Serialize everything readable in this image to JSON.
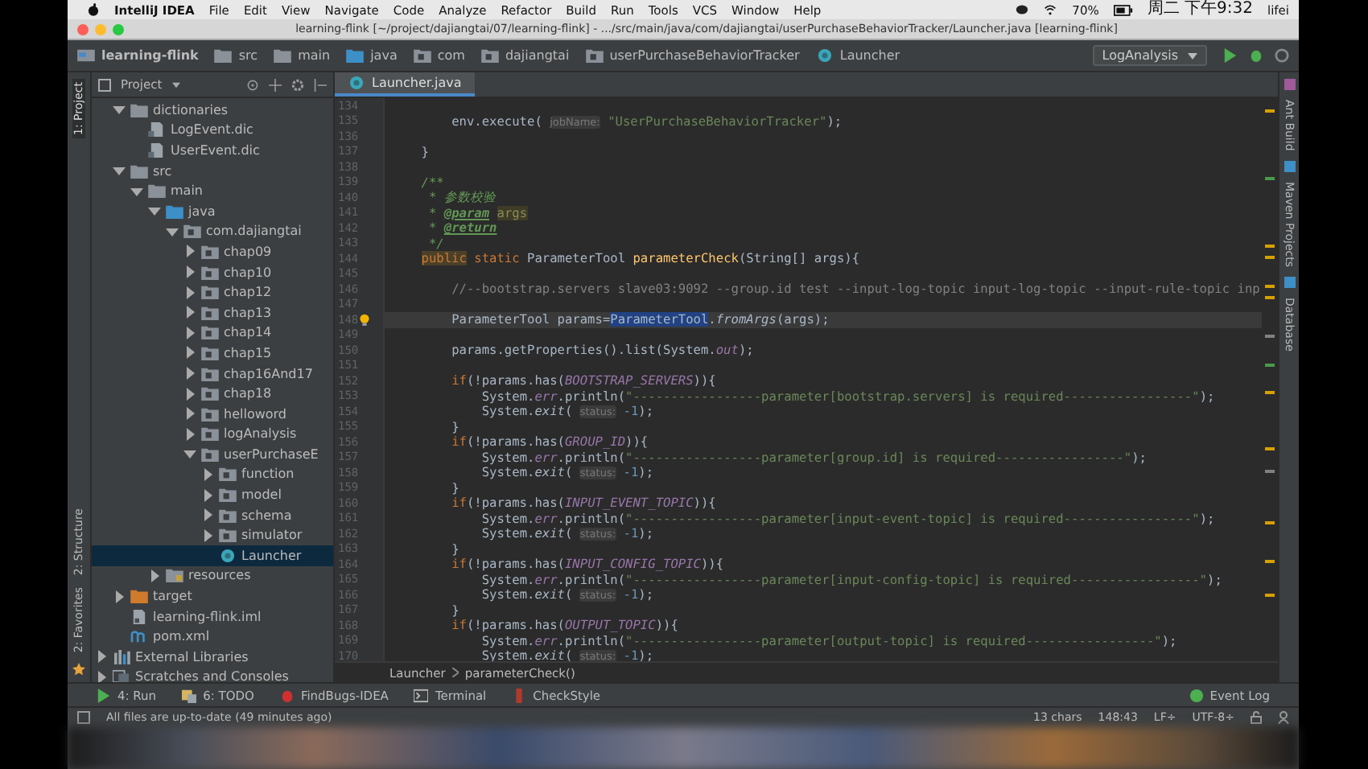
{
  "menu_bar": {
    "app": "IntelliJ IDEA",
    "items": [
      "File",
      "Edit",
      "View",
      "Navigate",
      "Code",
      "Analyze",
      "Refactor",
      "Build",
      "Run",
      "Tools",
      "VCS",
      "Window",
      "Help"
    ],
    "battery": "70%",
    "clock": "周二 下午9:32",
    "user": "lifei"
  },
  "window": {
    "title": "learning-flink [~/project/dajiangtai/07/learning-flink] - .../src/main/java/com/dajiangtai/userPurchaseBehaviorTracker/Launcher.java [learning-flink]"
  },
  "nav_bar": {
    "crumbs": [
      {
        "label": "learning-flink",
        "kind": "module"
      },
      {
        "label": "src",
        "kind": "folder"
      },
      {
        "label": "main",
        "kind": "folder"
      },
      {
        "label": "java",
        "kind": "source-folder"
      },
      {
        "label": "com",
        "kind": "package"
      },
      {
        "label": "dajiangtai",
        "kind": "package"
      },
      {
        "label": "userPurchaseBehaviorTracker",
        "kind": "package"
      },
      {
        "label": "Launcher",
        "kind": "class"
      }
    ],
    "run_config": "LogAnalysis"
  },
  "left_stripe": [
    {
      "label": "1: Project",
      "selected": true
    },
    {
      "label": "2: Structure",
      "selected": false
    },
    {
      "label": "2: Favorites",
      "selected": false
    }
  ],
  "right_stripe": [
    "Ant Build",
    "Maven Projects",
    "Database"
  ],
  "project_panel": {
    "title": "Project",
    "tree": [
      {
        "label": "dictionaries",
        "kind": "folder",
        "expanded": true,
        "selected": false,
        "children": [
          {
            "label": "LogEvent.dic",
            "kind": "dic",
            "selected": false
          },
          {
            "label": "UserEvent.dic",
            "kind": "dic",
            "selected": false
          }
        ]
      },
      {
        "label": "src",
        "kind": "folder",
        "expanded": true,
        "selected": false,
        "children": [
          {
            "label": "main",
            "kind": "folder",
            "expanded": true,
            "selected": false,
            "children": [
              {
                "label": "java",
                "kind": "source-folder",
                "expanded": true,
                "selected": false,
                "children": [
                  {
                    "label": "com.dajiangtai",
                    "kind": "package",
                    "expanded": true,
                    "selected": false,
                    "children": [
                      {
                        "label": "chap09",
                        "kind": "package",
                        "expanded": false,
                        "selected": false
                      },
                      {
                        "label": "chap10",
                        "kind": "package",
                        "expanded": false,
                        "selected": false
                      },
                      {
                        "label": "chap12",
                        "kind": "package",
                        "expanded": false,
                        "selected": false
                      },
                      {
                        "label": "chap13",
                        "kind": "package",
                        "expanded": false,
                        "selected": false
                      },
                      {
                        "label": "chap14",
                        "kind": "package",
                        "expanded": false,
                        "selected": false
                      },
                      {
                        "label": "chap15",
                        "kind": "package",
                        "expanded": false,
                        "selected": false
                      },
                      {
                        "label": "chap16And17",
                        "kind": "package",
                        "expanded": false,
                        "selected": false
                      },
                      {
                        "label": "chap18",
                        "kind": "package",
                        "expanded": false,
                        "selected": false
                      },
                      {
                        "label": "helloword",
                        "kind": "package",
                        "expanded": false,
                        "selected": false
                      },
                      {
                        "label": "logAnalysis",
                        "kind": "package",
                        "expanded": false,
                        "selected": false
                      },
                      {
                        "label": "userPurchaseE",
                        "kind": "package",
                        "expanded": true,
                        "selected": false,
                        "children": [
                          {
                            "label": "function",
                            "kind": "package",
                            "expanded": false,
                            "selected": false
                          },
                          {
                            "label": "model",
                            "kind": "package",
                            "expanded": false,
                            "selected": false
                          },
                          {
                            "label": "schema",
                            "kind": "package",
                            "expanded": false,
                            "selected": false
                          },
                          {
                            "label": "simulator",
                            "kind": "package",
                            "expanded": false,
                            "selected": false
                          },
                          {
                            "label": "Launcher",
                            "kind": "class",
                            "selected": true
                          }
                        ]
                      }
                    ]
                  }
                ]
              },
              {
                "label": "resources",
                "kind": "resources",
                "expanded": false,
                "selected": false
              }
            ]
          }
        ]
      },
      {
        "label": "target",
        "kind": "excluded-folder",
        "expanded": false,
        "selected": false
      },
      {
        "label": "learning-flink.iml",
        "kind": "iml",
        "selected": false
      },
      {
        "label": "pom.xml",
        "kind": "maven",
        "selected": false
      }
    ],
    "roots": [
      {
        "label": "External Libraries",
        "kind": "libraries",
        "expanded": false,
        "selected": false
      },
      {
        "label": "Scratches and Consoles",
        "kind": "scratches",
        "expanded": false,
        "selected": false
      }
    ]
  },
  "editor": {
    "tabs": [
      {
        "label": "Launcher.java",
        "selected": true
      }
    ],
    "lines": [
      {
        "n": "134"
      },
      {
        "n": "135",
        "tokens": [
          {
            "text": "        env.execute( ",
            "kind": "plain"
          },
          {
            "text": "jobName:",
            "kind": "hint"
          },
          {
            "text": " \"UserPurchaseBehaviorTracker\"",
            "kind": "str"
          },
          {
            "text": ");",
            "kind": "plain"
          }
        ]
      },
      {
        "n": "136"
      },
      {
        "n": "137",
        "tokens": [
          {
            "text": "    }",
            "kind": "plain"
          }
        ]
      },
      {
        "n": "138"
      },
      {
        "n": "139",
        "tokens": [
          {
            "text": "    /**",
            "kind": "doc"
          }
        ]
      },
      {
        "n": "140",
        "tokens": [
          {
            "text": "     * 参数校验",
            "kind": "doc"
          }
        ]
      },
      {
        "n": "141",
        "tokens": [
          {
            "text": "     * ",
            "kind": "doc"
          },
          {
            "text": "@param",
            "kind": "doctag"
          },
          {
            "text": " args",
            "kind": "docparam"
          }
        ]
      },
      {
        "n": "142",
        "tokens": [
          {
            "text": "     * ",
            "kind": "doc"
          },
          {
            "text": "@return",
            "kind": "doctag"
          }
        ]
      },
      {
        "n": "143",
        "tokens": [
          {
            "text": "     */",
            "kind": "doc"
          }
        ]
      },
      {
        "n": "144",
        "tokens": [
          {
            "text": "    public",
            "kind": "kwhl"
          },
          {
            "text": " static ",
            "kind": "kw"
          },
          {
            "text": "ParameterTool ",
            "kind": "plain"
          },
          {
            "text": "parameterCheck",
            "kind": "fn"
          },
          {
            "text": "(String[] args){",
            "kind": "plain"
          }
        ]
      },
      {
        "n": "145"
      },
      {
        "n": "146",
        "tokens": [
          {
            "text": "        //--bootstrap.servers slave03:9092 --group.id test --input-log-topic input-log-topic --input-rule-topic inp",
            "kind": "comment"
          }
        ]
      },
      {
        "n": "147"
      },
      {
        "n": "148",
        "current": true,
        "bulb": true,
        "tokens": [
          {
            "text": "        ParameterTool params=",
            "kind": "plain"
          },
          {
            "text": "ParameterTool",
            "kind": "sel"
          },
          {
            "text": ".",
            "kind": "plain"
          },
          {
            "text": "fromArgs",
            "kind": "static"
          },
          {
            "text": "(args);",
            "kind": "plain"
          }
        ]
      },
      {
        "n": "149"
      },
      {
        "n": "150",
        "tokens": [
          {
            "text": "        params.getProperties().list(System.",
            "kind": "plain"
          },
          {
            "text": "out",
            "kind": "field"
          },
          {
            "text": ");",
            "kind": "plain"
          }
        ]
      },
      {
        "n": "151"
      },
      {
        "n": "152",
        "tokens": [
          {
            "text": "        if",
            "kind": "kw"
          },
          {
            "text": "(!params.has(",
            "kind": "plain"
          },
          {
            "text": "BOOTSTRAP_SERVERS",
            "kind": "field"
          },
          {
            "text": ")){",
            "kind": "plain"
          }
        ]
      },
      {
        "n": "153",
        "tokens": [
          {
            "text": "            System.",
            "kind": "plain"
          },
          {
            "text": "err",
            "kind": "field"
          },
          {
            "text": ".println(",
            "kind": "plain"
          },
          {
            "text": "\"-----------------parameter[bootstrap.servers] is required-----------------\"",
            "kind": "str"
          },
          {
            "text": ");",
            "kind": "plain"
          }
        ]
      },
      {
        "n": "154",
        "tokens": [
          {
            "text": "            System.",
            "kind": "plain"
          },
          {
            "text": "exit",
            "kind": "static"
          },
          {
            "text": "( ",
            "kind": "plain"
          },
          {
            "text": "status:",
            "kind": "hint"
          },
          {
            "text": " -1",
            "kind": "num"
          },
          {
            "text": ");",
            "kind": "plain"
          }
        ]
      },
      {
        "n": "155",
        "tokens": [
          {
            "text": "        }",
            "kind": "plain"
          }
        ]
      },
      {
        "n": "156",
        "tokens": [
          {
            "text": "        if",
            "kind": "kw"
          },
          {
            "text": "(!params.has(",
            "kind": "plain"
          },
          {
            "text": "GROUP_ID",
            "kind": "field"
          },
          {
            "text": ")){",
            "kind": "plain"
          }
        ]
      },
      {
        "n": "157",
        "tokens": [
          {
            "text": "            System.",
            "kind": "plain"
          },
          {
            "text": "err",
            "kind": "field"
          },
          {
            "text": ".println(",
            "kind": "plain"
          },
          {
            "text": "\"-----------------parameter[group.id] is required-----------------\"",
            "kind": "str"
          },
          {
            "text": ");",
            "kind": "plain"
          }
        ]
      },
      {
        "n": "158",
        "tokens": [
          {
            "text": "            System.",
            "kind": "plain"
          },
          {
            "text": "exit",
            "kind": "static"
          },
          {
            "text": "( ",
            "kind": "plain"
          },
          {
            "text": "status:",
            "kind": "hint"
          },
          {
            "text": " -1",
            "kind": "num"
          },
          {
            "text": ");",
            "kind": "plain"
          }
        ]
      },
      {
        "n": "159",
        "tokens": [
          {
            "text": "        }",
            "kind": "plain"
          }
        ]
      },
      {
        "n": "160",
        "tokens": [
          {
            "text": "        if",
            "kind": "kw"
          },
          {
            "text": "(!params.has(",
            "kind": "plain"
          },
          {
            "text": "INPUT_EVENT_TOPIC",
            "kind": "field"
          },
          {
            "text": ")){",
            "kind": "plain"
          }
        ]
      },
      {
        "n": "161",
        "tokens": [
          {
            "text": "            System.",
            "kind": "plain"
          },
          {
            "text": "err",
            "kind": "field"
          },
          {
            "text": ".println(",
            "kind": "plain"
          },
          {
            "text": "\"-----------------parameter[input-event-topic] is required-----------------\"",
            "kind": "str"
          },
          {
            "text": ");",
            "kind": "plain"
          }
        ]
      },
      {
        "n": "162",
        "tokens": [
          {
            "text": "            System.",
            "kind": "plain"
          },
          {
            "text": "exit",
            "kind": "static"
          },
          {
            "text": "( ",
            "kind": "plain"
          },
          {
            "text": "status:",
            "kind": "hint"
          },
          {
            "text": " -1",
            "kind": "num"
          },
          {
            "text": ");",
            "kind": "plain"
          }
        ]
      },
      {
        "n": "163",
        "tokens": [
          {
            "text": "        }",
            "kind": "plain"
          }
        ]
      },
      {
        "n": "164",
        "tokens": [
          {
            "text": "        if",
            "kind": "kw"
          },
          {
            "text": "(!params.has(",
            "kind": "plain"
          },
          {
            "text": "INPUT_CONFIG_TOPIC",
            "kind": "field"
          },
          {
            "text": ")){",
            "kind": "plain"
          }
        ]
      },
      {
        "n": "165",
        "tokens": [
          {
            "text": "            System.",
            "kind": "plain"
          },
          {
            "text": "err",
            "kind": "field"
          },
          {
            "text": ".println(",
            "kind": "plain"
          },
          {
            "text": "\"-----------------parameter[input-config-topic] is required-----------------\"",
            "kind": "str"
          },
          {
            "text": ");",
            "kind": "plain"
          }
        ]
      },
      {
        "n": "166",
        "tokens": [
          {
            "text": "            System.",
            "kind": "plain"
          },
          {
            "text": "exit",
            "kind": "static"
          },
          {
            "text": "( ",
            "kind": "plain"
          },
          {
            "text": "status:",
            "kind": "hint"
          },
          {
            "text": " -1",
            "kind": "num"
          },
          {
            "text": ");",
            "kind": "plain"
          }
        ]
      },
      {
        "n": "167",
        "tokens": [
          {
            "text": "        }",
            "kind": "plain"
          }
        ]
      },
      {
        "n": "168",
        "tokens": [
          {
            "text": "        if",
            "kind": "kw"
          },
          {
            "text": "(!params.has(",
            "kind": "plain"
          },
          {
            "text": "OUTPUT_TOPIC",
            "kind": "field"
          },
          {
            "text": ")){",
            "kind": "plain"
          }
        ]
      },
      {
        "n": "169",
        "tokens": [
          {
            "text": "            System.",
            "kind": "plain"
          },
          {
            "text": "err",
            "kind": "field"
          },
          {
            "text": ".println(",
            "kind": "plain"
          },
          {
            "text": "\"-----------------parameter[output-topic] is required-----------------\"",
            "kind": "str"
          },
          {
            "text": ");",
            "kind": "plain"
          }
        ]
      },
      {
        "n": "170",
        "tokens": [
          {
            "text": "            System.",
            "kind": "plain"
          },
          {
            "text": "exit",
            "kind": "static"
          },
          {
            "text": "( ",
            "kind": "plain"
          },
          {
            "text": "status:",
            "kind": "hint"
          },
          {
            "text": " -1",
            "kind": "num"
          },
          {
            "text": ");",
            "kind": "plain"
          }
        ]
      }
    ],
    "breadcrumb": [
      "Launcher",
      "parameterCheck()"
    ]
  },
  "tool_windows": [
    {
      "label": "4: Run",
      "kind": "run"
    },
    {
      "label": "6: TODO",
      "kind": "todo"
    },
    {
      "label": "FindBugs-IDEA",
      "kind": "findbugs"
    },
    {
      "label": "Terminal",
      "kind": "terminal"
    },
    {
      "label": "CheckStyle",
      "kind": "checkstyle"
    }
  ],
  "event_log": "Event Log",
  "status_bar": {
    "message": "All files are up-to-date (49 minutes ago)",
    "selection": "13 chars",
    "position": "148:43",
    "line_separator": "LF÷",
    "encoding": "UTF-8÷"
  }
}
